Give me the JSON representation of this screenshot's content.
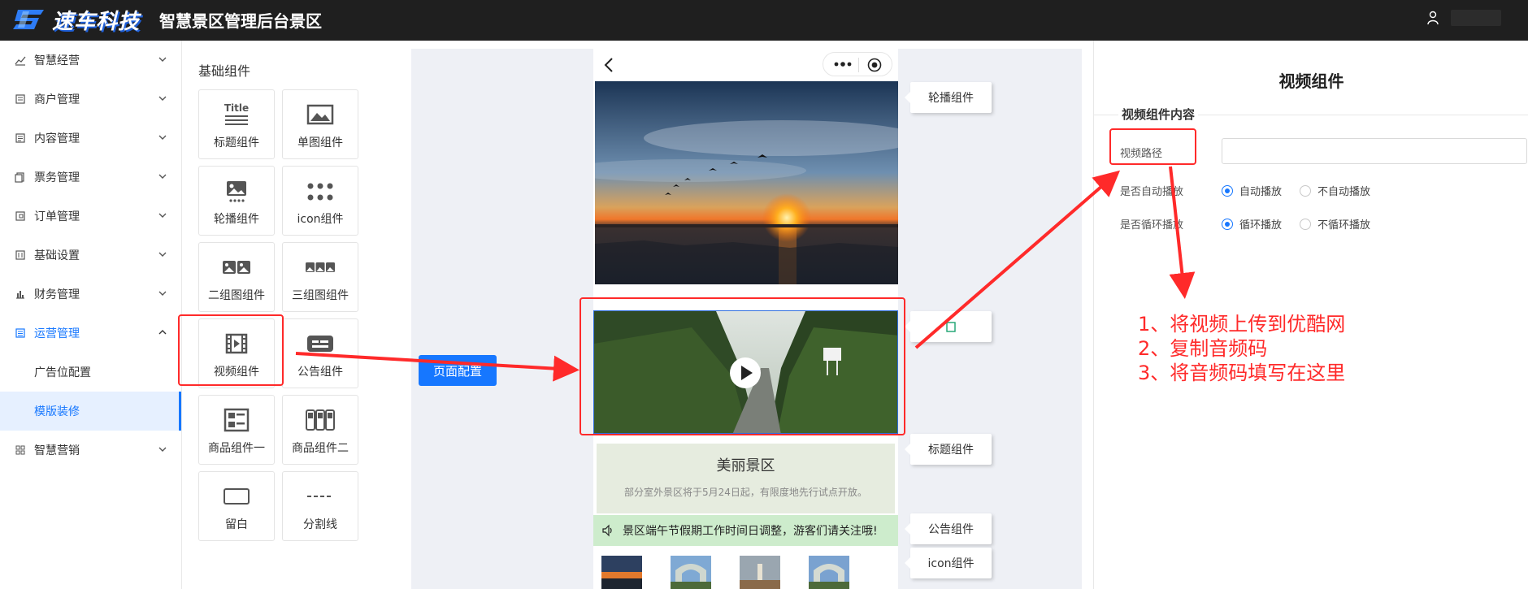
{
  "header": {
    "brand": "速车科技",
    "title": "智慧景区管理后台景区"
  },
  "sidebar": {
    "items": [
      {
        "label": "智慧经营",
        "icon": "chart-line-icon",
        "expanded": false
      },
      {
        "label": "商户管理",
        "icon": "store-icon",
        "expanded": false
      },
      {
        "label": "内容管理",
        "icon": "document-icon",
        "expanded": false
      },
      {
        "label": "票务管理",
        "icon": "ticket-icon",
        "expanded": false
      },
      {
        "label": "订单管理",
        "icon": "order-icon",
        "expanded": false
      },
      {
        "label": "基础设置",
        "icon": "settings-icon",
        "expanded": false
      },
      {
        "label": "财务管理",
        "icon": "bar-chart-icon",
        "expanded": false
      },
      {
        "label": "运营管理",
        "icon": "operations-icon",
        "expanded": true
      },
      {
        "label": "智慧营销",
        "icon": "grid-icon",
        "expanded": false
      }
    ],
    "sub_items": [
      {
        "label": "广告位配置",
        "selected": false
      },
      {
        "label": "模版装修",
        "selected": true
      }
    ]
  },
  "palette": {
    "title": "基础组件",
    "components": [
      {
        "label": "标题组件",
        "icon": "title-icon"
      },
      {
        "label": "单图组件",
        "icon": "image-icon"
      },
      {
        "label": "轮播组件",
        "icon": "carousel-icon"
      },
      {
        "label": "icon组件",
        "icon": "dots-grid-icon"
      },
      {
        "label": "二组图组件",
        "icon": "two-images-icon"
      },
      {
        "label": "三组图组件",
        "icon": "three-images-icon"
      },
      {
        "label": "视频组件",
        "icon": "video-icon"
      },
      {
        "label": "公告组件",
        "icon": "notice-icon"
      },
      {
        "label": "商品组件一",
        "icon": "product-list-icon"
      },
      {
        "label": "商品组件二",
        "icon": "product-grid-icon"
      },
      {
        "label": "留白",
        "icon": "blank-icon"
      },
      {
        "label": "分割线",
        "icon": "divider-icon"
      }
    ]
  },
  "canvas": {
    "page_button": "页面配置",
    "tags": {
      "carousel": "轮播组件",
      "title": "标题组件",
      "notice": "公告组件",
      "icon": "icon组件"
    },
    "title_block": {
      "main": "美丽景区",
      "sub": "部分室外景区将于5月24日起，有限度地先行试点开放。"
    },
    "notice_text": "景区端午节假期工作时间日调整，游客们请关注哦!"
  },
  "config": {
    "title": "视频组件",
    "section": "视频组件内容",
    "path_label": "视频路径",
    "path_value": "",
    "autoplay_label": "是否自动播放",
    "autoplay_options": [
      "自动播放",
      "不自动播放"
    ],
    "autoplay_selected": "自动播放",
    "loop_label": "是否循环播放",
    "loop_options": [
      "循环播放",
      "不循环播放"
    ],
    "loop_selected": "循环播放"
  },
  "annotation": {
    "steps": [
      "1、将视频上传到优酷网",
      "2、复制音频码",
      "3、将音频码填写在这里"
    ],
    "color": "#ff2a2a"
  },
  "colors": {
    "accent": "#1677ff",
    "header_bg": "#1f1f1f",
    "canvas_bg": "#eef0f5",
    "notice_bg": "#cdeccc"
  }
}
